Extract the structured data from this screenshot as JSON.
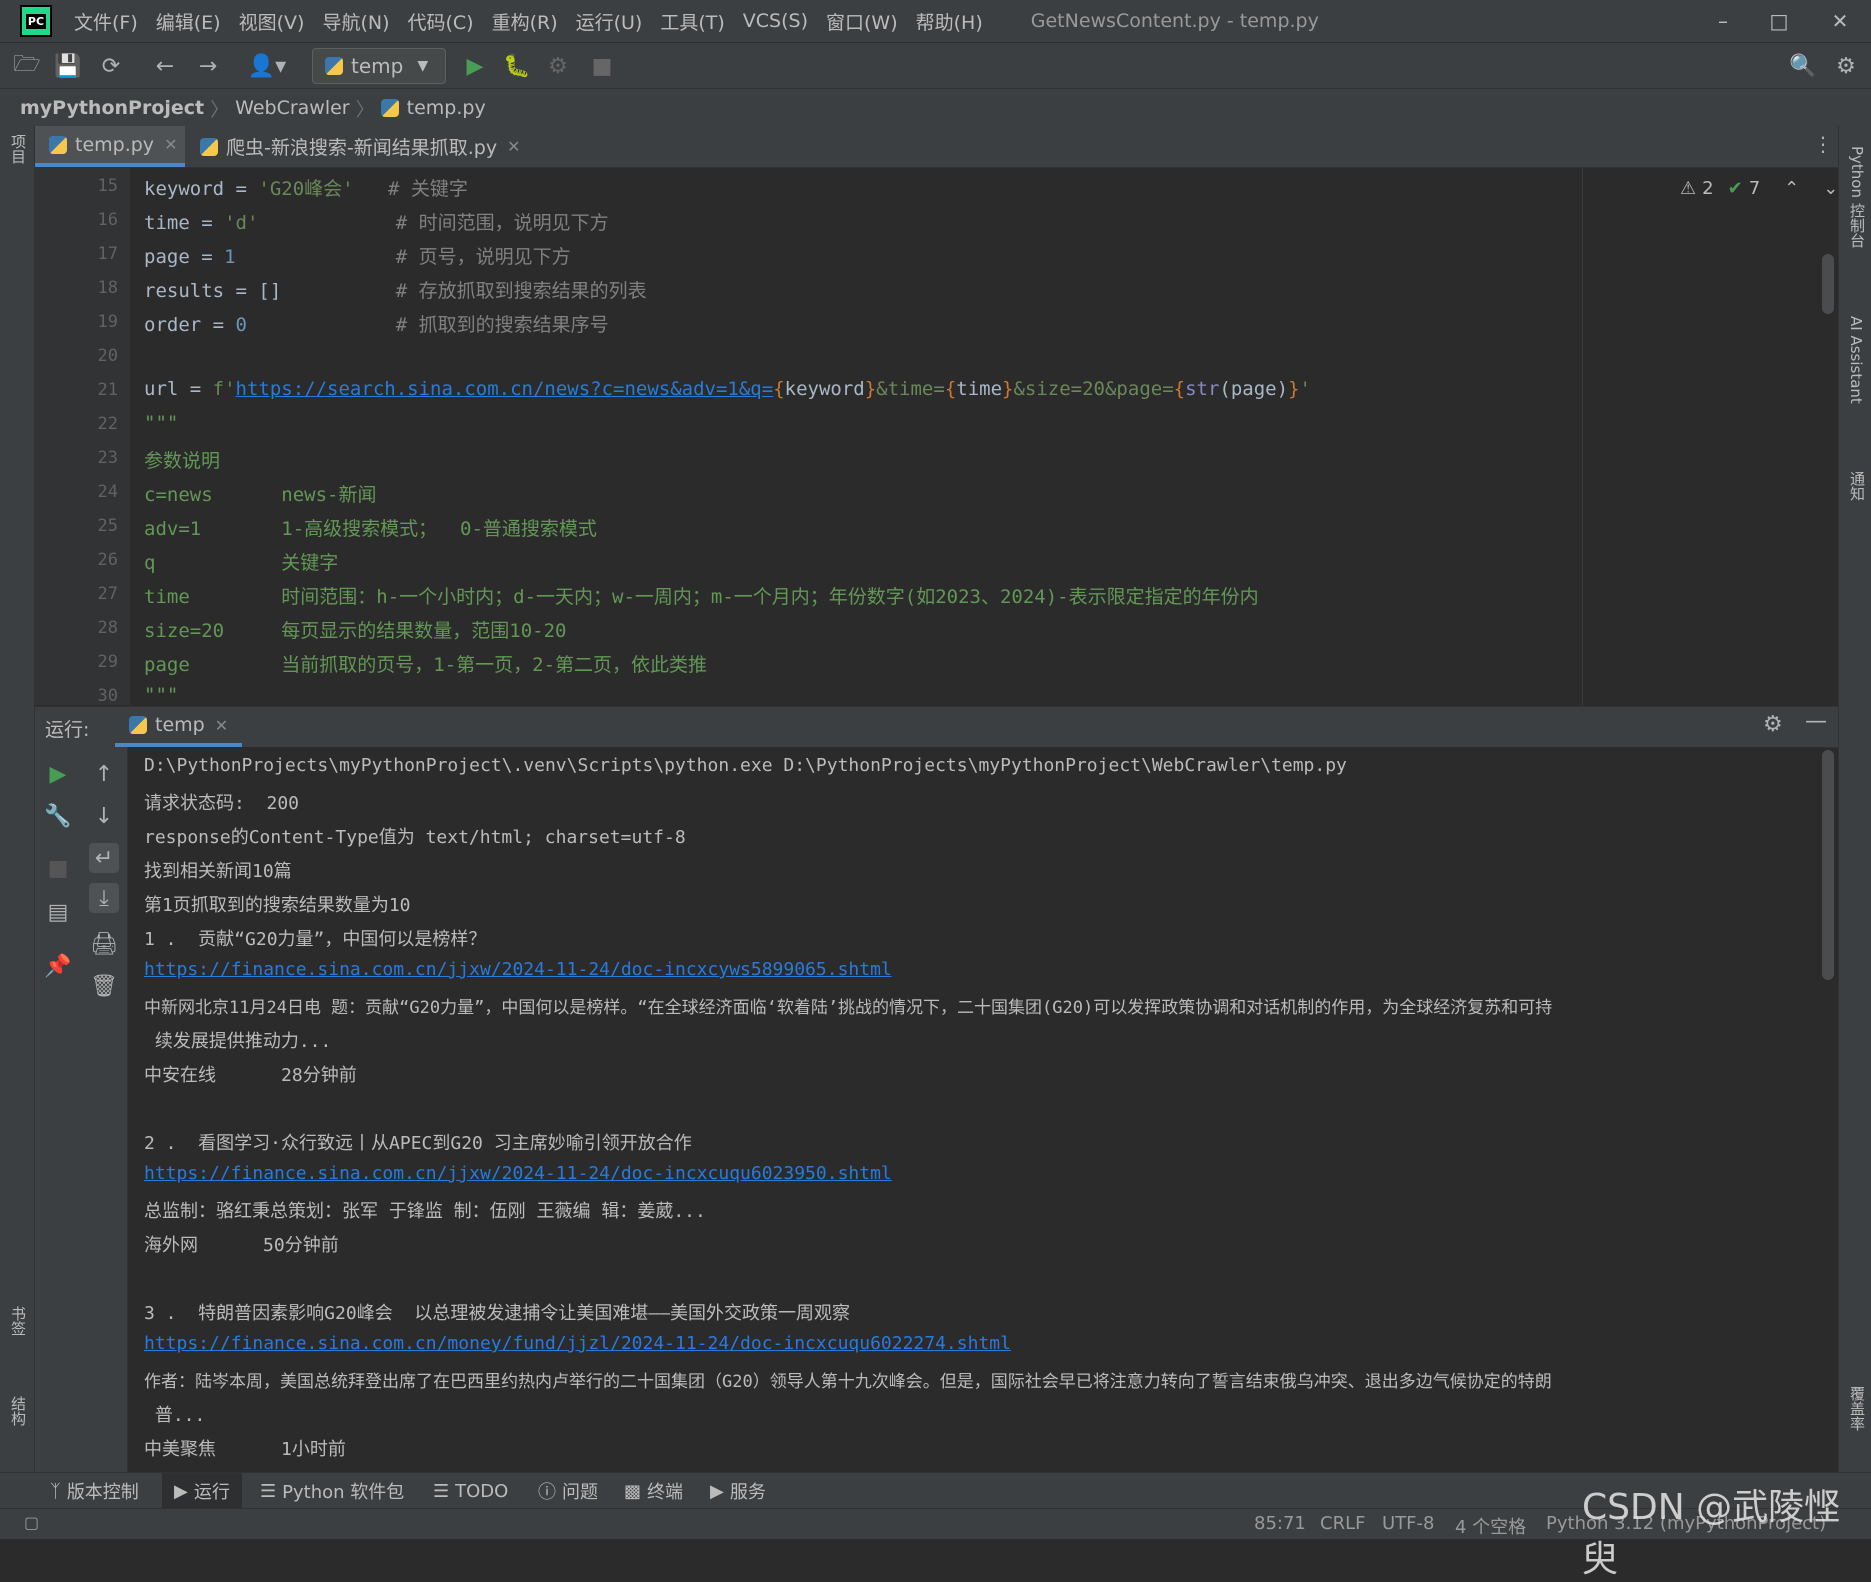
{
  "titlebar": {
    "menus": [
      "文件(F)",
      "编辑(E)",
      "视图(V)",
      "导航(N)",
      "代码(C)",
      "重构(R)",
      "运行(U)",
      "工具(T)",
      "VCS(S)",
      "窗口(W)",
      "帮助(H)"
    ],
    "window_title": "GetNewsContent.py - temp.py",
    "logo_text": "PC"
  },
  "toolbar": {
    "run_config": "temp"
  },
  "breadcrumb": {
    "project": "myPythonProject",
    "folder": "WebCrawler",
    "file": "temp.py"
  },
  "left_strip": {
    "project_label": "项目",
    "bookmarks_label": "书签",
    "structure_label": "结构"
  },
  "right_strip": {
    "python_console": "Python 控制台",
    "ai_assistant": "AI Assistant",
    "notifications": "通知",
    "coverage": "覆盖率"
  },
  "tabs": [
    {
      "label": "temp.py"
    },
    {
      "label": "爬虫-新浪搜索-新闻结果抓取.py"
    }
  ],
  "inspections": {
    "warnings": "2",
    "checks": "7"
  },
  "editor": {
    "line_numbers": [
      "15",
      "16",
      "17",
      "18",
      "19",
      "20",
      "21",
      "22",
      "23",
      "24",
      "25",
      "26",
      "27",
      "28",
      "29",
      "30"
    ],
    "lines": {
      "l15": {
        "var": "keyword",
        "op": " = ",
        "val": "'G20峰会'",
        "pad": "   ",
        "cmt": "# 关键字"
      },
      "l16": {
        "var": "time",
        "op": " = ",
        "val": "'d'",
        "pad": "            ",
        "cmt": "# 时间范围，说明见下方"
      },
      "l17": {
        "var": "page",
        "op": " = ",
        "val": "1",
        "pad": "              ",
        "cmt": "# 页号，说明见下方"
      },
      "l18": {
        "var": "results",
        "op": " = ",
        "val": "[]",
        "pad": "          ",
        "cmt": "# 存放抓取到搜索结果的列表"
      },
      "l19": {
        "var": "order",
        "op": " = ",
        "val": "0",
        "pad": "             ",
        "cmt": "# 抓取到的搜索结果序号"
      },
      "l21": {
        "var": "url",
        "op": " = ",
        "prefix": "f'",
        "url_text": "https://search.sina.com.cn/news?c=news&adv=1&q=",
        "b1o": "{",
        "p1": "keyword",
        "b1c": "}",
        "s2": "&time=",
        "b2o": "{",
        "p2": "time",
        "b2c": "}",
        "s3": "&size=20&page=",
        "b3o": "{",
        "fn": "str",
        "p3": "(page)",
        "b3c": "}",
        "end": "'"
      },
      "l22": "\"\"\"",
      "l23": "参数说明",
      "l24": "c=news      news-新闻",
      "l25": "adv=1       1-高级搜索模式；  0-普通搜索模式",
      "l26": "q           关键字",
      "l27": "time        时间范围：h-一个小时内；d-一天内；w-一周内；m-一个月内；年份数字(如2023、2024)-表示限定指定的年份内",
      "l28": "size=20     每页显示的结果数量，范围10-20",
      "l29": "page        当前抓取的页号，1-第一页，2-第二页，依此类推",
      "l30": "\"\"\""
    }
  },
  "run_panel": {
    "label": "运行:",
    "tab": "temp"
  },
  "console": {
    "lines": [
      "D:\\PythonProjects\\myPythonProject\\.venv\\Scripts\\python.exe D:\\PythonProjects\\myPythonProject\\WebCrawler\\temp.py",
      "请求状态码:  200",
      "response的Content-Type值为 text/html; charset=utf-8",
      "找到相关新闻10篇",
      "第1页抓取到的搜索结果数量为10",
      "1 .  贡献“G20力量”，中国何以是榜样？",
      "https://finance.sina.com.cn/jjxw/2024-11-24/doc-incxcyws5899065.shtml",
      "中新网北京11月24日电 题：贡献“G20力量”，中国何以是榜样。“在全球经济面临‘软着陆’挑战的情况下，二十国集团(G20)可以发挥政策协调和对话机制的作用，为全球经济复苏和可持",
      " 续发展提供推动力...",
      "中安在线      28分钟前",
      "",
      "2 .  看图学习·众行致远丨从APEC到G20 习主席妙喻引领开放合作",
      "https://finance.sina.com.cn/jjxw/2024-11-24/doc-incxcuqu6023950.shtml",
      "总监制：骆红秉总策划：张军 于锋监 制：伍刚 王薇编 辑：姜葳...",
      "海外网      50分钟前",
      "",
      "3 .  特朗普因素影响G20峰会  以总理被发逮捕令让美国难堪——美国外交政策一周观察",
      "https://finance.sina.com.cn/money/fund/jjzl/2024-11-24/doc-incxcuqu6022274.shtml",
      "作者：陆岑本周，美国总统拜登出席了在巴西里约热内卢举行的二十国集团（G20）领导人第十九次峰会。但是，国际社会早已将注意力转向了誓言结束俄乌冲突、退出多边气候协定的特朗",
      " 普...",
      "中美聚焦      1小时前"
    ]
  },
  "bottom_tabs": [
    {
      "label": "版本控制"
    },
    {
      "label": "运行"
    },
    {
      "label": "Python 软件包"
    },
    {
      "label": "TODO"
    },
    {
      "label": "问题"
    },
    {
      "label": "终端"
    },
    {
      "label": "服务"
    }
  ],
  "statusbar": {
    "position": "85:71",
    "line_ending": "CRLF",
    "encoding": "UTF-8",
    "indent": "4 个空格",
    "interpreter": "Python 3.12 (myPythonProject)"
  },
  "watermark": "CSDN @武陵悭臾",
  "colors": {
    "background": "#2b2b2b",
    "panel": "#3c3f41",
    "string": "#6a8759",
    "number": "#6897bb",
    "comment": "#808080",
    "link": "#287bde",
    "run_green": "#499c54"
  }
}
